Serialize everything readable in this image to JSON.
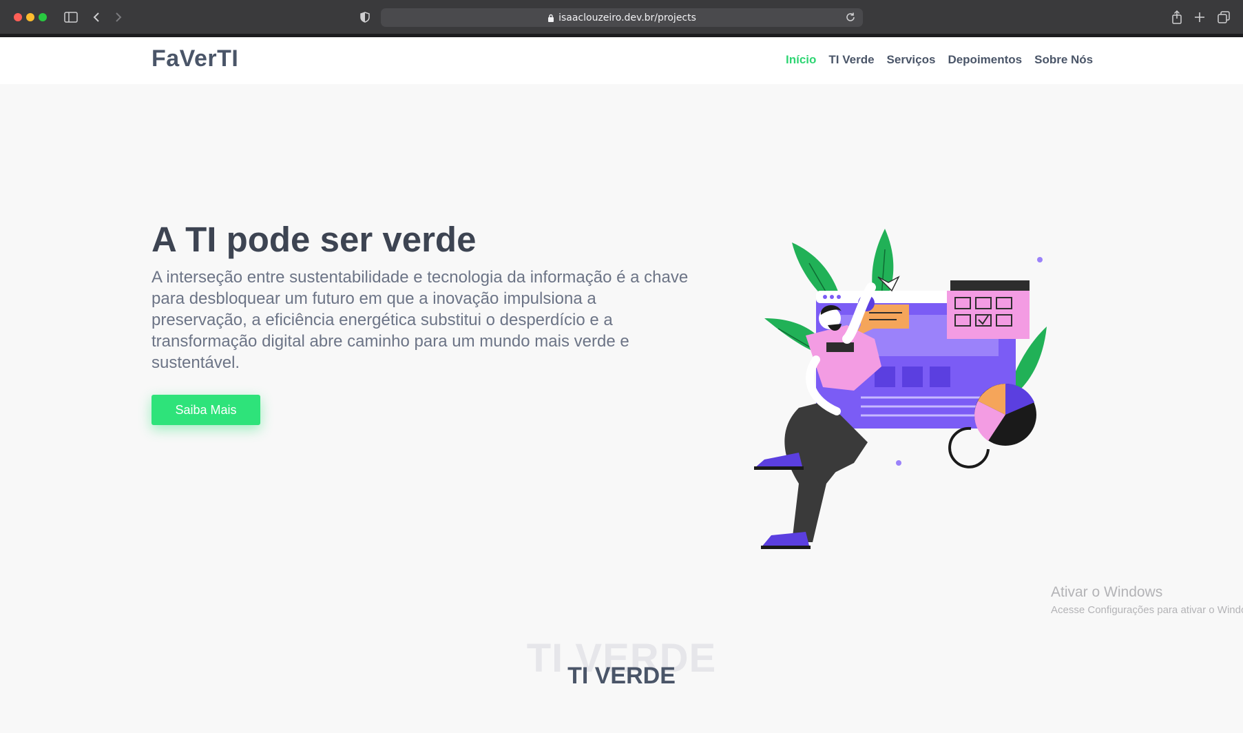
{
  "browser": {
    "url": "isaaclouzeiro.dev.br/projects",
    "icons": [
      "sidebar-icon",
      "back-icon",
      "forward-icon",
      "shield-icon",
      "lock-icon",
      "reload-icon",
      "share-icon",
      "new-tab-icon",
      "tabs-overview-icon"
    ]
  },
  "site": {
    "logo": "FaVerTI",
    "nav": [
      {
        "label": "Início",
        "active": true
      },
      {
        "label": "TI Verde",
        "active": false
      },
      {
        "label": "Serviços",
        "active": false
      },
      {
        "label": "Depoimentos",
        "active": false
      },
      {
        "label": "Sobre Nós",
        "active": false
      }
    ]
  },
  "hero": {
    "title": "A TI pode ser verde",
    "text": "A interseção entre sustentabilidade e tecnologia da informação é a chave para desbloquear um futuro em que a inovação impulsiona a preservação, a eficiência energética substitui o desperdício e a transformação digital abre caminho para um mundo mais verde e sustentável.",
    "button": "Saiba Mais"
  },
  "section": {
    "watermark": "TI VERDE",
    "heading": "TI VERDE"
  },
  "windows_watermark": {
    "title": "Ativar o Windows",
    "subtitle": "Acesse Configurações para ativar o Windows."
  },
  "colors": {
    "accent_green": "#2ed573",
    "button_green": "#2ee37a",
    "text_dark": "#3d4452",
    "illustration_purple": "#7b5cf5",
    "illustration_pink": "#f39ce3"
  }
}
